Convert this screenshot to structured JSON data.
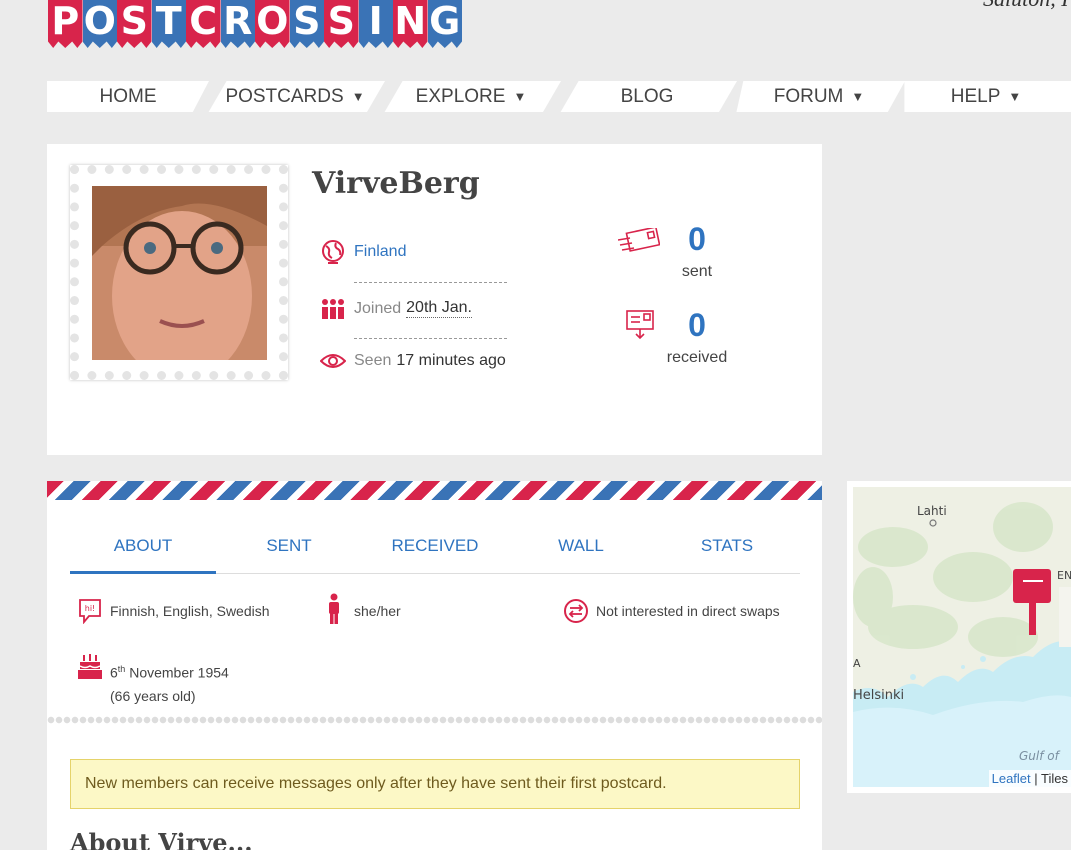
{
  "header": {
    "logo_letters": [
      "P",
      "O",
      "S",
      "T",
      "C",
      "R",
      "O",
      "S",
      "S",
      "I",
      "N",
      "G"
    ],
    "tagline": "Saluton, I"
  },
  "nav": [
    {
      "label": "HOME",
      "caret": ""
    },
    {
      "label": "POSTCARDS",
      "caret": "▼"
    },
    {
      "label": "EXPLORE",
      "caret": "▼"
    },
    {
      "label": "BLOG",
      "caret": ""
    },
    {
      "label": "FORUM",
      "caret": "▼"
    },
    {
      "label": "HELP",
      "caret": "▼"
    }
  ],
  "profile": {
    "username": "VirveBerg",
    "country": "Finland",
    "joined_label": "Joined",
    "joined_value": "20th Jan.",
    "seen_label": "Seen",
    "seen_value": "17 minutes ago",
    "sent_count": "0",
    "sent_label": "sent",
    "received_count": "0",
    "received_label": "received"
  },
  "tabs": [
    "ABOUT",
    "SENT",
    "RECEIVED",
    "WALL",
    "STATS"
  ],
  "facts": {
    "languages": "Finnish, English, Swedish",
    "pronouns": "she/her",
    "swaps": "Not interested in direct swaps",
    "birthday_day": "6",
    "birthday_suffix": "th",
    "birthday_rest": "November 1954",
    "age": "(66 years old)"
  },
  "notice": "New members can receive messages only after they have sent their first postcard.",
  "about_heading": "About Virve...",
  "map": {
    "labels": {
      "lahti": "Lahti",
      "helsinki": "Helsinki",
      "gulf": "Gulf of",
      "edge_a": "A",
      "edge_en": "EN"
    },
    "attribution_link": "Leaflet",
    "attribution_rest": "| Tiles"
  },
  "colors": {
    "brand_red": "#d8244b",
    "brand_blue": "#3a73b6",
    "link_blue": "#2f74c0",
    "notice_bg": "#fcf8c6"
  }
}
